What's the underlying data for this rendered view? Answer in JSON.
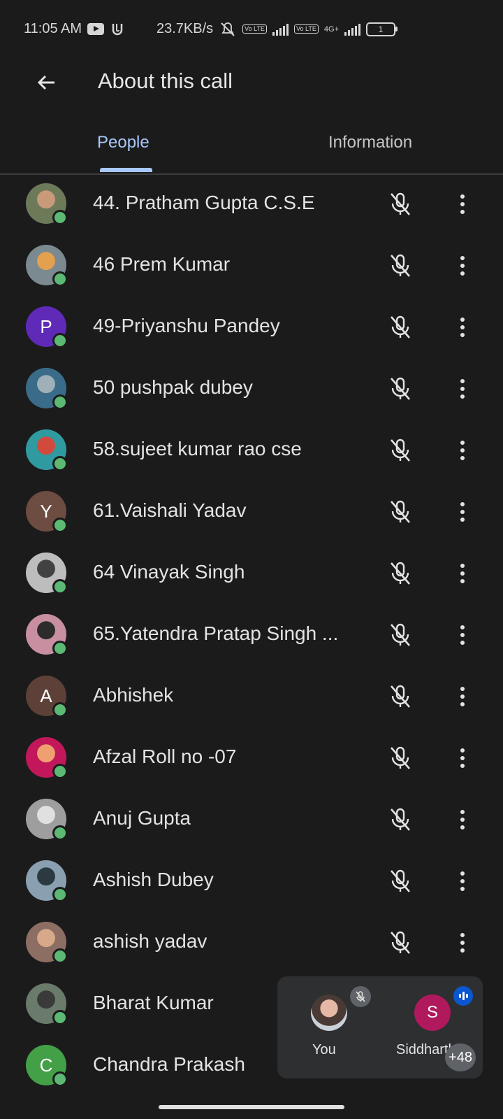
{
  "status_bar": {
    "time": "11:05 AM",
    "net_speed": "23.7KB/s",
    "volte1": "Vo LTE",
    "volte2": "Vo LTE",
    "network_type": "4G+",
    "battery": "1",
    "icons": [
      "youtube-icon",
      "app-notification-icon",
      "muted-bell-icon",
      "signal-icon",
      "signal-icon",
      "battery-icon"
    ]
  },
  "header": {
    "title": "About this call",
    "back_icon": "arrow-back-icon"
  },
  "tabs": [
    {
      "label": "People",
      "active": true
    },
    {
      "label": "Information",
      "active": false
    }
  ],
  "participants": [
    {
      "name": "44. Pratham Gupta C.S.E",
      "avatar": "photo",
      "colors": [
        "#6c7a5a",
        "#c99a7a"
      ],
      "muted": true
    },
    {
      "name": "46 Prem Kumar",
      "avatar": "photo",
      "colors": [
        "#7b8a90",
        "#e3a04f"
      ],
      "muted": true
    },
    {
      "name": "49-Priyanshu Pandey",
      "avatar": "letter",
      "letter": "P",
      "bg": "#5f2ab8",
      "muted": true
    },
    {
      "name": "50 pushpak dubey",
      "avatar": "photo",
      "colors": [
        "#3a6c8a",
        "#9fb0b8"
      ],
      "muted": true
    },
    {
      "name": "58.sujeet kumar rao cse",
      "avatar": "photo",
      "colors": [
        "#2f9aa0",
        "#d24a3b"
      ],
      "muted": true
    },
    {
      "name": "61.Vaishali Yadav",
      "avatar": "letter",
      "letter": "Y",
      "bg": "#6d4c41",
      "muted": true
    },
    {
      "name": "64 Vinayak Singh",
      "avatar": "photo",
      "colors": [
        "#bdbdbd",
        "#424242"
      ],
      "muted": true
    },
    {
      "name": "65.Yatendra Pratap Singh ...",
      "avatar": "photo",
      "colors": [
        "#c78fa0",
        "#2c2c2c"
      ],
      "muted": true
    },
    {
      "name": "Abhishek",
      "avatar": "letter",
      "letter": "A",
      "bg": "#5d4037",
      "muted": true
    },
    {
      "name": "Afzal Roll no -07",
      "avatar": "photo",
      "colors": [
        "#c2185b",
        "#f0a070"
      ],
      "muted": true
    },
    {
      "name": "Anuj Gupta",
      "avatar": "photo",
      "colors": [
        "#9e9e9e",
        "#e0e0e0"
      ],
      "muted": true
    },
    {
      "name": "Ashish Dubey",
      "avatar": "photo",
      "colors": [
        "#8aa0b0",
        "#2a3a40"
      ],
      "muted": true
    },
    {
      "name": "ashish yadav",
      "avatar": "photo",
      "colors": [
        "#8d6e63",
        "#d7a98a"
      ],
      "muted": true
    },
    {
      "name": "Bharat Kumar",
      "avatar": "photo",
      "colors": [
        "#6b7b6b",
        "#3a3a3a"
      ],
      "muted": false
    },
    {
      "name": "Chandra Prakash",
      "avatar": "letter",
      "letter": "C",
      "bg": "#43a047",
      "muted": false
    }
  ],
  "pip": {
    "self_label": "You",
    "other_letter": "S",
    "other_label": "Siddharth",
    "extra_count": "+48"
  },
  "colors": {
    "background": "#1b1b1c",
    "accent": "#a8c7fa",
    "online": "#5bb974"
  }
}
